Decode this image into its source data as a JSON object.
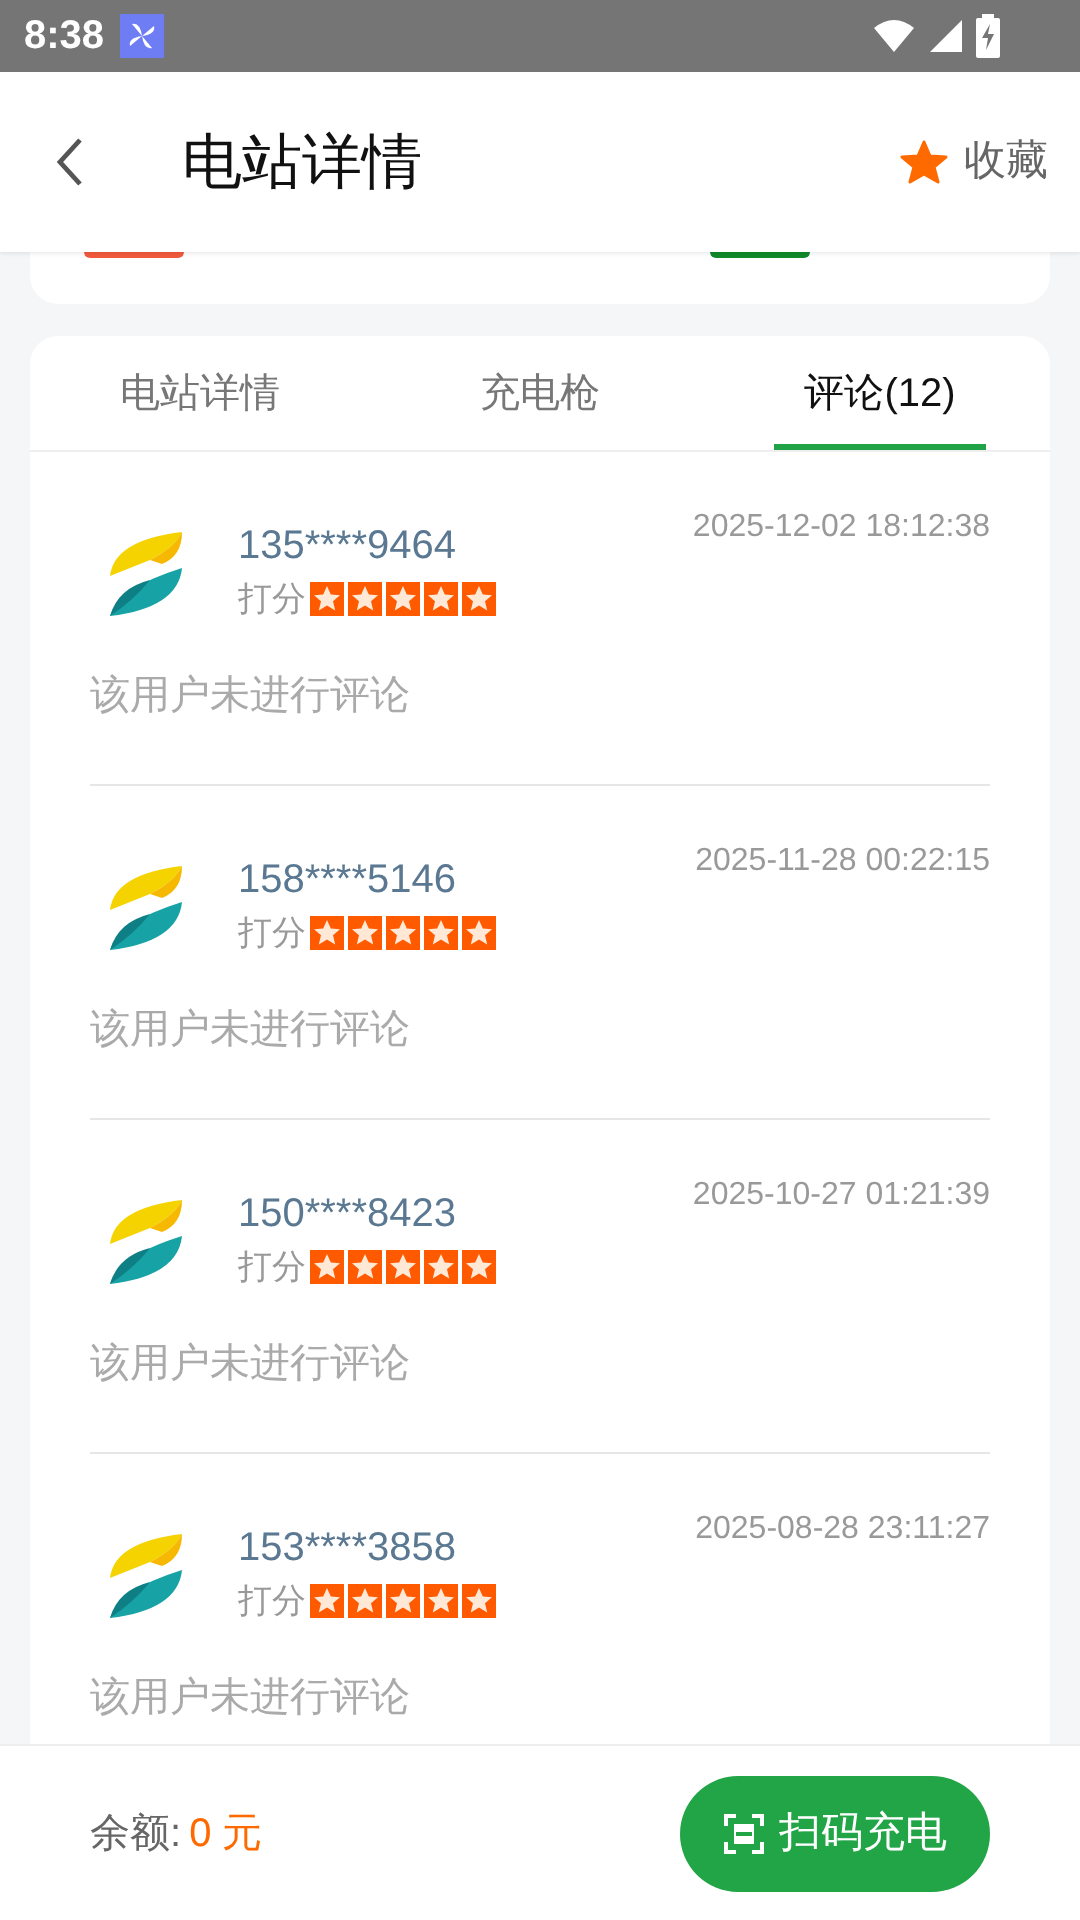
{
  "status_bar": {
    "time": "8:38"
  },
  "header": {
    "title": "电站详情",
    "favorite": {
      "label": "收藏"
    }
  },
  "tabs": [
    {
      "label": "电站详情",
      "selected": false
    },
    {
      "label": "充电枪",
      "selected": false
    },
    {
      "label": "评论(12)",
      "selected": true
    }
  ],
  "reviews": [
    {
      "user": "135****9464",
      "time": "2025-12-02 18:12:38",
      "rating_label": "打分",
      "stars": 5,
      "comment": "该用户未进行评论"
    },
    {
      "user": "158****5146",
      "time": "2025-11-28 00:22:15",
      "rating_label": "打分",
      "stars": 5,
      "comment": "该用户未进行评论"
    },
    {
      "user": "150****8423",
      "time": "2025-10-27 01:21:39",
      "rating_label": "打分",
      "stars": 5,
      "comment": "该用户未进行评论"
    },
    {
      "user": "153****3858",
      "time": "2025-08-28 23:11:27",
      "rating_label": "打分",
      "stars": 5,
      "comment": "该用户未进行评论"
    }
  ],
  "footer": {
    "balance_label": "余额:",
    "balance_value": "0 元",
    "scan_button": "扫码充电"
  }
}
